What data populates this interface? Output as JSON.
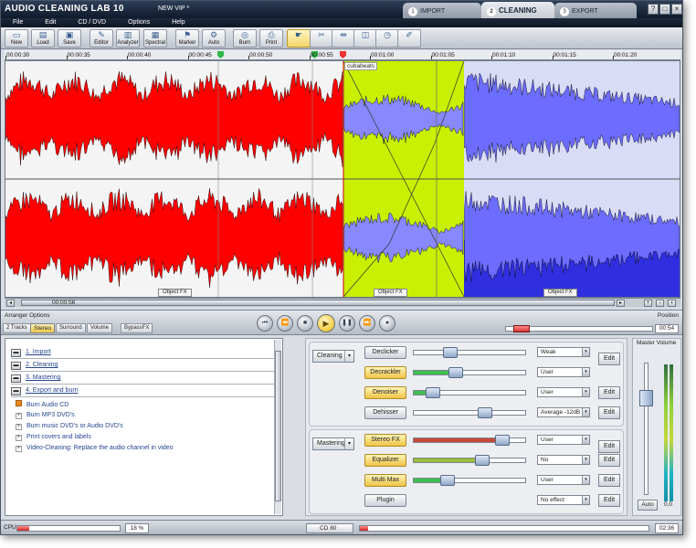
{
  "app": {
    "title": "AUDIO CLEANING LAB 10",
    "document": "NEW VIP *"
  },
  "tabs": [
    {
      "num": "1",
      "label": "IMPORT"
    },
    {
      "num": "2",
      "label": "CLEANING"
    },
    {
      "num": "3",
      "label": "EXPORT"
    }
  ],
  "window_buttons": {
    "help": "?",
    "restore": "□",
    "close": "×"
  },
  "menu": [
    "File",
    "Edit",
    "CD / DVD",
    "Options",
    "Help"
  ],
  "toolbar": [
    {
      "label": "New",
      "icon": "new-doc-icon",
      "glyph": "▭"
    },
    {
      "label": "Load",
      "icon": "folder-icon",
      "glyph": "▤"
    },
    {
      "label": "Save",
      "icon": "save-icon",
      "glyph": "▣"
    },
    {
      "label": "Editor",
      "icon": "editor-icon",
      "glyph": "✎"
    },
    {
      "label": "Analyzer",
      "icon": "analyzer-icon",
      "glyph": "▥"
    },
    {
      "label": "Spectral",
      "icon": "spectral-icon",
      "glyph": "▦"
    },
    {
      "label": "Marker",
      "icon": "marker-icon",
      "glyph": "⚑"
    },
    {
      "label": "Auto",
      "icon": "auto-icon",
      "glyph": "⚙"
    },
    {
      "label": "Burn",
      "icon": "burn-icon",
      "glyph": "◎"
    },
    {
      "label": "Print",
      "icon": "print-icon",
      "glyph": "⎙"
    },
    {
      "label": "",
      "icon": "hand-pointer-icon",
      "glyph": "☛"
    },
    {
      "label": "",
      "icon": "cut-icon",
      "glyph": "✂"
    },
    {
      "label": "",
      "icon": "split-icon",
      "glyph": "⇹"
    },
    {
      "label": "",
      "icon": "eraser-icon",
      "glyph": "◫"
    },
    {
      "label": "",
      "icon": "clock-icon",
      "glyph": "◷"
    },
    {
      "label": "",
      "icon": "pen-icon",
      "glyph": "✐"
    }
  ],
  "ruler": [
    "00:00:30",
    "00:00:35",
    "00:00:40",
    "00:00:45",
    "00:00:50",
    "00:00:55",
    "00:01:00",
    "00:01:05",
    "00:01:10",
    "00:01:15",
    "00:01:20"
  ],
  "clip_name": "cubabeats",
  "object_fx": "Object FX",
  "scroll_position": "00:00:56",
  "transport": {
    "arranger_label": "Arranger Options",
    "position_label": "Position",
    "track_buttons": [
      "2 Tracks",
      "Stereo",
      "Surround",
      "Volume",
      "BypassFX"
    ],
    "position_time": "00:54"
  },
  "tree": {
    "sections": [
      "1. Import",
      "2. Cleaning",
      "3. Mastering",
      "4. Export and burn"
    ],
    "items": [
      "Burn Audio CD",
      "Burn MP3 DVD's",
      "Burn music DVD's or Audio DVD's",
      "Print covers and labels",
      "Video-Cleaning: Replace the audio channel in video"
    ]
  },
  "cleaning": {
    "category": "Cleaning",
    "effects": [
      {
        "label": "Declicker",
        "active": false,
        "value": 0.3,
        "preset": "Weak",
        "edit": "Edit",
        "fill": ""
      },
      {
        "label": "Decrackler",
        "active": true,
        "value": 0.35,
        "preset": "User",
        "edit": "",
        "fill": "#3fbf4f"
      },
      {
        "label": "Denoiser",
        "active": true,
        "value": 0.12,
        "preset": "User",
        "edit": "Edit",
        "fill": "#3fbf4f"
      },
      {
        "label": "Dehisser",
        "active": false,
        "value": 0.65,
        "preset": "Average -12dB",
        "edit": "Edit",
        "fill": ""
      }
    ]
  },
  "mastering": {
    "category": "Mastering",
    "effects": [
      {
        "label": "Stereo FX",
        "active": true,
        "value": 0.82,
        "preset": "User",
        "edit": "Edit",
        "fill": "#c9473a"
      },
      {
        "label": "Equalizer",
        "active": true,
        "value": 0.62,
        "preset": "No",
        "edit": "Edit",
        "fill": "#9bbf3a"
      },
      {
        "label": "Multi Max",
        "active": true,
        "value": 0.27,
        "preset": "User",
        "edit": "Edit",
        "fill": "#3fbf4f"
      },
      {
        "label": "Plugin",
        "active": false,
        "value": null,
        "preset": "No effect",
        "edit": "Edit",
        "fill": ""
      }
    ]
  },
  "master_volume": {
    "label": "Master Volume",
    "auto": "Auto",
    "value": "0.0"
  },
  "status": {
    "cpu_label": "CPU",
    "cpu_percent": "18 %",
    "cd_type": "CD 80",
    "time": "02:36",
    "cpu_level": 0.12,
    "cd_usage": 0.03
  },
  "colors": {
    "red_track": "#ff0000",
    "yellow_track": "#c8f000",
    "blue_track": "#7070ff",
    "playhead_accent": "#f3cd3f"
  }
}
